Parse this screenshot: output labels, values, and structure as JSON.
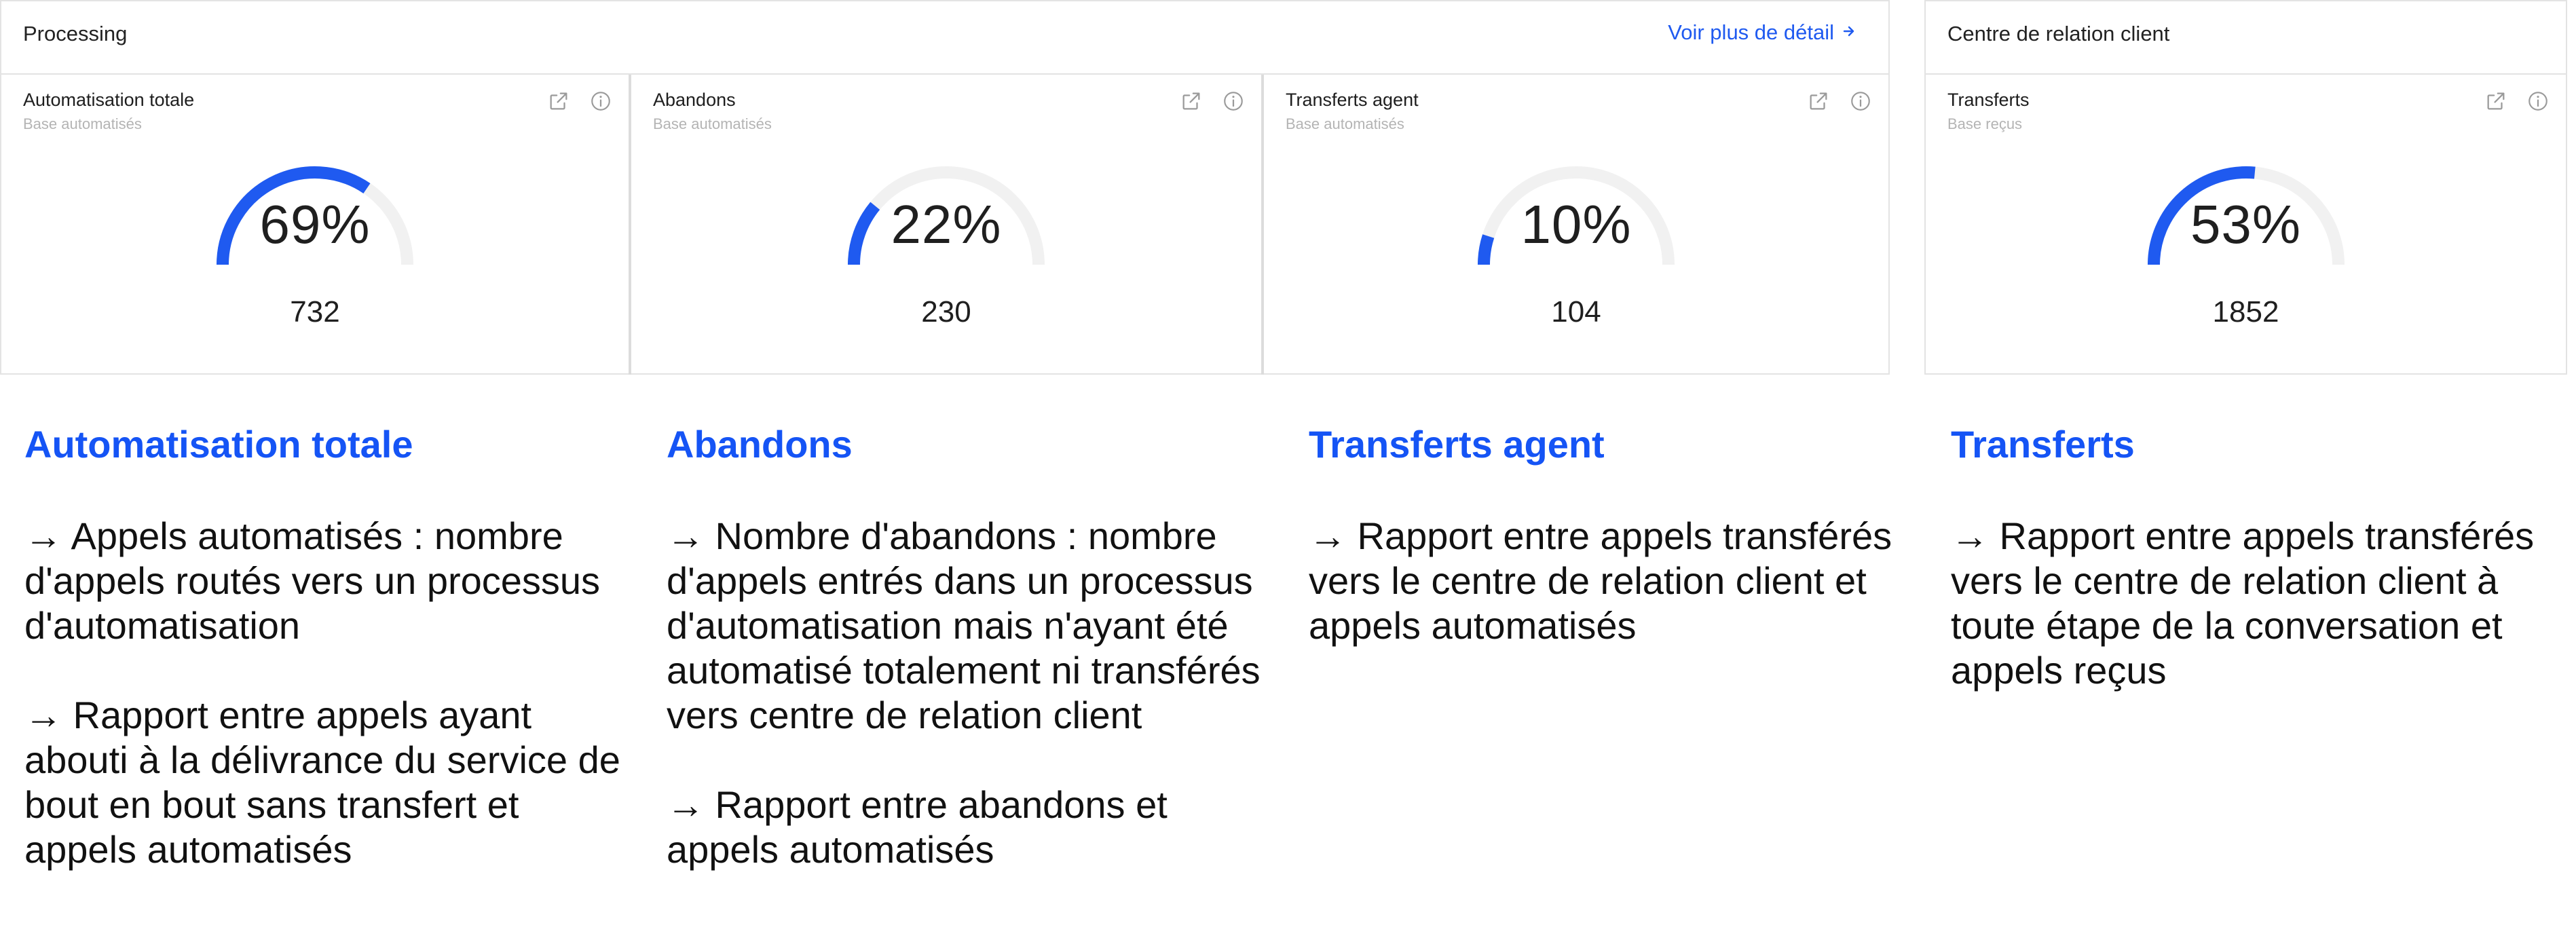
{
  "panels": {
    "processing": {
      "title": "Processing",
      "detail_link": "Voir plus de détail"
    },
    "crc": {
      "title": "Centre de relation client"
    }
  },
  "cards": [
    {
      "title": "Automatisation totale",
      "subtitle": "Base automatisés",
      "percent_label": "69%",
      "percent": 0.69,
      "count": "732"
    },
    {
      "title": "Abandons",
      "subtitle": "Base automatisés",
      "percent_label": "22%",
      "percent": 0.22,
      "count": "230"
    },
    {
      "title": "Transferts agent",
      "subtitle": "Base automatisés",
      "percent_label": "10%",
      "percent": 0.1,
      "count": "104"
    },
    {
      "title": "Transferts",
      "subtitle": "Base reçus",
      "percent_label": "53%",
      "percent": 0.53,
      "count": "1852"
    }
  ],
  "icons": {
    "open": "external-link-icon",
    "info": "info-icon",
    "arrow": "arrow-right-icon"
  },
  "colors": {
    "accent": "#1554f5",
    "gauge_fill": "#1f5af0",
    "gauge_track": "#f1f1f1"
  },
  "descriptions": [
    {
      "title": "Automatisation totale",
      "lines": [
        "→ Appels automatisés : nombre d'appels routés vers un processus d'automatisation",
        "→ Rapport entre appels ayant abouti à la délivrance du service de bout en bout sans transfert et appels automatisés"
      ]
    },
    {
      "title": "Abandons",
      "lines": [
        "→ Nombre d'abandons : nombre d'appels entrés dans un processus d'automatisation mais n'ayant été automatisé totalement ni transférés vers centre de relation client",
        "→ Rapport entre abandons et appels automatisés"
      ]
    },
    {
      "title": "Transferts agent",
      "lines": [
        "→ Rapport entre appels transférés vers le centre de relation client et appels automatisés"
      ]
    },
    {
      "title": "Transferts",
      "lines": [
        "→ Rapport entre appels transférés vers le centre de relation client à toute étape de la conversation et appels reçus"
      ]
    }
  ]
}
